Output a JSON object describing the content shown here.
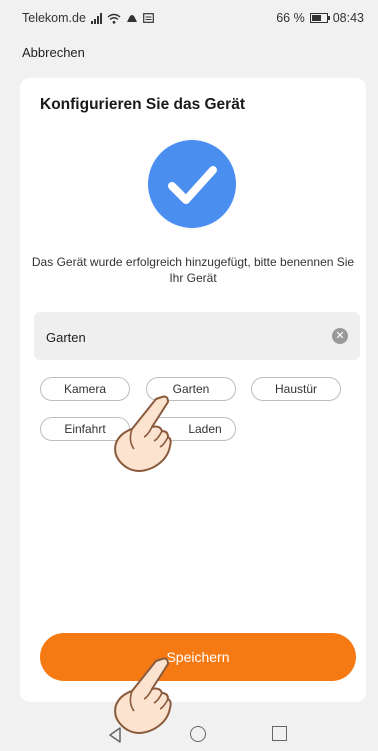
{
  "status_bar": {
    "carrier": "Telekom.de",
    "battery_percent": "66 %",
    "time": "08:43",
    "icons": [
      "signal-icon",
      "wifi-icon",
      "cloud-icon",
      "message-icon",
      "battery-icon"
    ]
  },
  "header": {
    "cancel_label": "Abbrechen"
  },
  "card": {
    "title": "Konfigurieren Sie das Gerät",
    "success_icon": "checkmark-icon",
    "message": "Das Gerät wurde erfolgreich hinzugefügt, bitte benennen Sie Ihr Gerät",
    "name_input": {
      "value": "Garten"
    },
    "suggestions": [
      "Kamera",
      "Garten",
      "Haustür",
      "Einfahrt",
      "Laden"
    ],
    "save_label": "Speichern"
  },
  "nav_bar": {
    "icons": [
      "back-icon",
      "home-icon",
      "recent-apps-icon"
    ]
  },
  "colors": {
    "accent": "#f67a13",
    "success": "#4a8ff0"
  }
}
